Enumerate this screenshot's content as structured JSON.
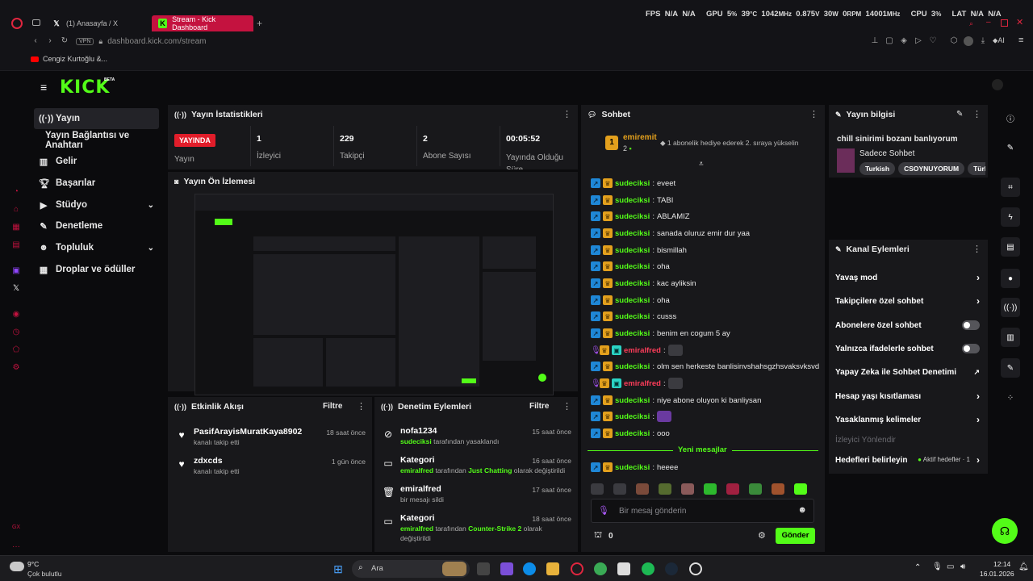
{
  "browser": {
    "tabs": [
      {
        "label": "(1) Anasayfa / X"
      },
      {
        "label": "Stream - Kick Dashboard"
      }
    ],
    "url": "dashboard.kick.com/stream",
    "vpn": "VPN",
    "bookmark": "Cengiz Kurtoğlu &...",
    "ai_label": "AI"
  },
  "hud": {
    "fps_label": "FPS",
    "fps1": "N/A",
    "fps2": "N/A",
    "gpu_label": "GPU",
    "gpu_load": "5",
    "gpu_load_unit": "%",
    "gpu_temp": "39",
    "gpu_temp_unit": "°C",
    "gpu_clock": "1042",
    "gpu_clock_unit": "MHz",
    "gpu_volt": "0.875",
    "gpu_volt_unit": "V",
    "gpu_power": "30",
    "gpu_power_unit": "W",
    "gpu_fan": "0",
    "gpu_fan_unit": "RPM",
    "gpu_mem": "14001",
    "gpu_mem_unit": "MHz",
    "cpu_label": "CPU",
    "cpu_load": "3",
    "cpu_unit": "%",
    "lat_label": "LAT",
    "lat1": "N/A",
    "lat2": "N/A"
  },
  "app": {
    "logo": "KICK",
    "beta": "BETA"
  },
  "sidenav": {
    "items": [
      {
        "label": "Yayın",
        "icon": "broadcast-icon"
      },
      {
        "label": "Yayın Bağlantısı ve Anahtarı"
      },
      {
        "label": "Gelir",
        "icon": "revenue-icon"
      },
      {
        "label": "Başarılar",
        "icon": "trophy-icon"
      },
      {
        "label": "Stüdyo",
        "icon": "studio-icon"
      },
      {
        "label": "Denetleme",
        "icon": "wrench-icon"
      },
      {
        "label": "Topluluk",
        "icon": "community-icon"
      },
      {
        "label": "Droplar ve ödüller",
        "icon": "drops-icon"
      }
    ]
  },
  "stats": {
    "title": "Yayın İstatistikleri",
    "live_badge": "YAYINDA",
    "items": [
      {
        "value": "1",
        "label": "İzleyici"
      },
      {
        "value": "229",
        "label": "Takipçi"
      },
      {
        "value": "2",
        "label": "Abone Sayısı"
      },
      {
        "value": "00:05:52",
        "label": "Yayında Olduğu Süre"
      }
    ],
    "live_label": "Yayın"
  },
  "preview": {
    "title": "Yayın Ön İzlemesi"
  },
  "activity": {
    "title": "Etkinlik Akışı",
    "filter": "Filtre",
    "events": [
      {
        "user": "PasifArayisMuratKaya8902",
        "sub": "kanalı takip etti",
        "time": "18 saat önce"
      },
      {
        "user": "zdxcds",
        "sub": "kanalı takip etti",
        "time": "1 gün önce"
      }
    ]
  },
  "moderation": {
    "title": "Denetim Eylemleri",
    "filter": "Filtre",
    "events": [
      {
        "title": "nofa1234",
        "by": "sudeciksi",
        "rest": " tarafından yasaklandı",
        "time": "15 saat önce"
      },
      {
        "title": "Kategori",
        "by": "emiralfred",
        "mid": " tarafından ",
        "cat": "Just Chatting",
        "rest": " olarak değiştirildi",
        "time": "16 saat önce"
      },
      {
        "title": "emiralfred",
        "sub": "bir mesajı sildi",
        "time": "17 saat önce"
      },
      {
        "title": "Kategori",
        "by": "emiralfred",
        "mid": " tarafından ",
        "cat": "Counter-Strike 2",
        "rest": " olarak",
        "rest2": "değiştirildi",
        "time": "18 saat önce"
      }
    ]
  },
  "chat": {
    "title": "Sohbet",
    "pinned_user": "emiremit",
    "pinned_rank": "1",
    "pinned_count": "2",
    "pinned_msg": "1 abonelik hediye ederek 2. sıraya yükselin",
    "messages": [
      {
        "user": "sudeciksi",
        "text": "eveet"
      },
      {
        "user": "sudeciksi",
        "text": "TABI"
      },
      {
        "user": "sudeciksi",
        "text": "ABLAMIZ"
      },
      {
        "user": "sudeciksi",
        "text": "sanada oluruz emir dur yaa"
      },
      {
        "user": "sudeciksi",
        "text": "bismillah"
      },
      {
        "user": "sudeciksi",
        "text": "oha"
      },
      {
        "user": "sudeciksi",
        "text": "kac ayliksin"
      },
      {
        "user": "sudeciksi",
        "text": "oha"
      },
      {
        "user": "sudeciksi",
        "text": "cusss"
      },
      {
        "user": "sudeciksi",
        "text": "benim en cogum 5 ay"
      },
      {
        "user": "emiralfred",
        "text": ""
      },
      {
        "user": "sudeciksi",
        "text": "olm sen herkeste banlisinvshahsgzhsvaksvksvd"
      },
      {
        "user": "emiralfred",
        "text": ""
      },
      {
        "user": "sudeciksi",
        "text": "niye abone oluyon ki banliysan"
      },
      {
        "user": "sudeciksi",
        "text": ""
      },
      {
        "user": "sudeciksi",
        "text": "ooo"
      }
    ],
    "new_messages": "Yeni mesajlar",
    "last_msg": {
      "user": "sudeciksi",
      "text": "heeee"
    },
    "input_placeholder": "Bir mesaj gönderin",
    "points": "0",
    "send": "Gönder"
  },
  "stream_info": {
    "title": "Yayın bilgisi",
    "stream_title": "chill sinirimi bozanı banlıyorum",
    "category": "Sadece Sohbet",
    "tags": [
      "Turkish",
      "CSOYNUYORUM",
      "Türkç"
    ]
  },
  "channel_actions": {
    "title": "Kanal Eylemleri",
    "items": [
      {
        "label": "Yavaş mod"
      },
      {
        "label": "Takipçilere özel sohbet"
      },
      {
        "label": "Abonelere özel sohbet"
      },
      {
        "label": "Yalnızca ifadelerle sohbet"
      },
      {
        "label": "Yapay Zeka ile Sohbet Denetimi"
      },
      {
        "label": "Hesap yaşı kısıtlaması"
      },
      {
        "label": "Yasaklanmış kelimeler"
      },
      {
        "label": "İzleyici Yönlendir"
      },
      {
        "label": "Hedefleri belirleyin"
      }
    ],
    "active_goals": "Aktif hedefler · 1"
  },
  "taskbar": {
    "weather_temp": "9°C",
    "weather_desc": "Çok bulutlu",
    "search": "Ara",
    "time": "12:14",
    "date": "16.01.2026"
  }
}
